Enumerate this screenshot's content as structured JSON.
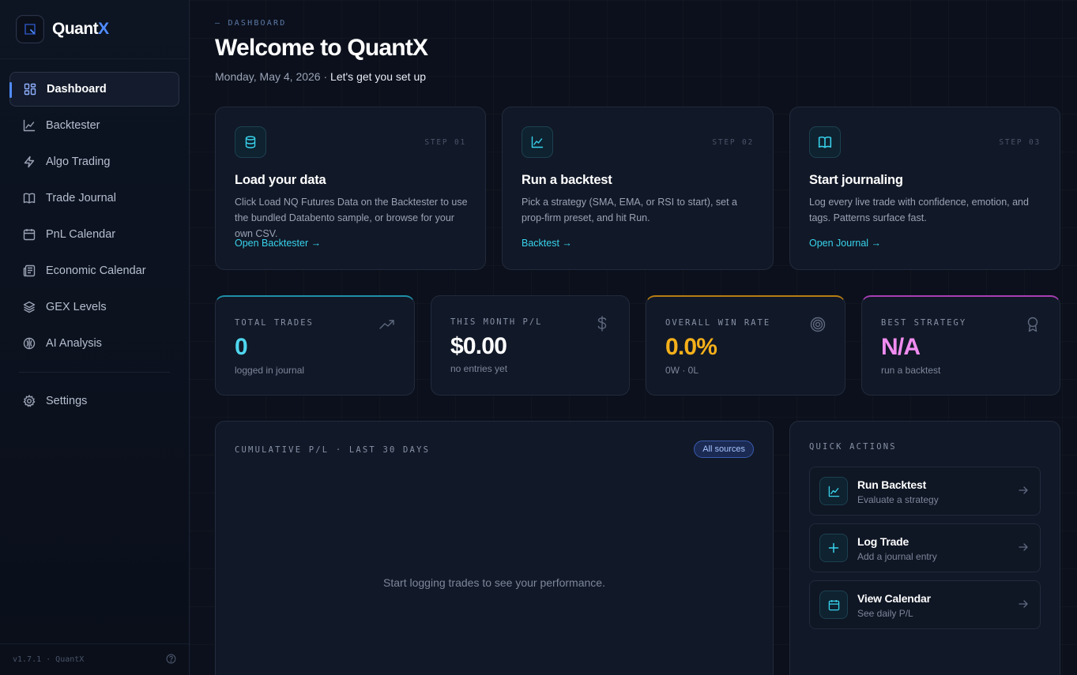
{
  "brand": {
    "name_prefix": "Quant",
    "name_suffix": "X"
  },
  "sidebar": {
    "items": [
      {
        "label": "Dashboard",
        "icon": "grid-icon",
        "active": true
      },
      {
        "label": "Backtester",
        "icon": "line-chart-icon"
      },
      {
        "label": "Algo Trading",
        "icon": "lightning-icon"
      },
      {
        "label": "Trade Journal",
        "icon": "book-icon"
      },
      {
        "label": "PnL Calendar",
        "icon": "calendar-icon"
      },
      {
        "label": "Economic Calendar",
        "icon": "newspaper-icon"
      },
      {
        "label": "GEX Levels",
        "icon": "layers-icon"
      },
      {
        "label": "AI Analysis",
        "icon": "brain-icon"
      }
    ],
    "settings": {
      "label": "Settings",
      "icon": "gear-icon"
    },
    "footer": {
      "version": "v1.7.1 · QuantX",
      "help_icon": "help-icon"
    }
  },
  "header": {
    "breadcrumb": "— DASHBOARD",
    "title": "Welcome to QuantX",
    "date": "Monday, May 4, 2026 · ",
    "tagline": "Let's get you set up"
  },
  "steps": [
    {
      "step": "STEP 01",
      "icon": "database-icon",
      "title": "Load your data",
      "desc": "Click Load NQ Futures Data on the Backtester to use the bundled Databento sample, or browse for your own CSV.",
      "link": "Open Backtester →"
    },
    {
      "step": "STEP 02",
      "icon": "chart-icon",
      "title": "Run a backtest",
      "desc": "Pick a strategy (SMA, EMA, or RSI to start), set a prop-firm preset, and hit Run.",
      "link": "Backtest →"
    },
    {
      "step": "STEP 03",
      "icon": "book-icon",
      "title": "Start journaling",
      "desc": "Log every live trade with confidence, emotion, and tags. Patterns surface fast.",
      "link": "Open Journal →"
    }
  ],
  "stats": [
    {
      "label": "TOTAL TRADES",
      "value": "0",
      "sub": "logged in journal",
      "icon": "trend-up-icon",
      "color": "#4fd6ee",
      "accent": "#1f8fa8"
    },
    {
      "label": "THIS MONTH P/L",
      "value": "$0.00",
      "sub": "no entries yet",
      "icon": "dollar-icon",
      "color": "#ffffff",
      "accent": "#222b3c"
    },
    {
      "label": "OVERALL WIN RATE",
      "value": "0.0%",
      "sub": "0W · 0L",
      "icon": "target-icon",
      "color": "#f5b01a",
      "accent": "#b87d12"
    },
    {
      "label": "BEST STRATEGY",
      "value": "N/A",
      "sub": "run a backtest",
      "icon": "award-icon",
      "color": "#f08cf0",
      "accent": "#a93fb4"
    }
  ],
  "chart_panel": {
    "title": "CUMULATIVE P/L · LAST 30 DAYS",
    "filter": "All sources",
    "empty": "Start logging trades to see your performance."
  },
  "quick_actions": {
    "title": "QUICK ACTIONS",
    "items": [
      {
        "title": "Run Backtest",
        "sub": "Evaluate a strategy",
        "icon": "chart-icon"
      },
      {
        "title": "Log Trade",
        "sub": "Add a journal entry",
        "icon": "plus-icon"
      },
      {
        "title": "View Calendar",
        "sub": "See daily P/L",
        "icon": "calendar-icon"
      }
    ]
  },
  "colors": {
    "accent_blue": "#4f8cff",
    "accent_cyan": "#38d3ec",
    "background": "#0b101c",
    "card": "#111827"
  }
}
